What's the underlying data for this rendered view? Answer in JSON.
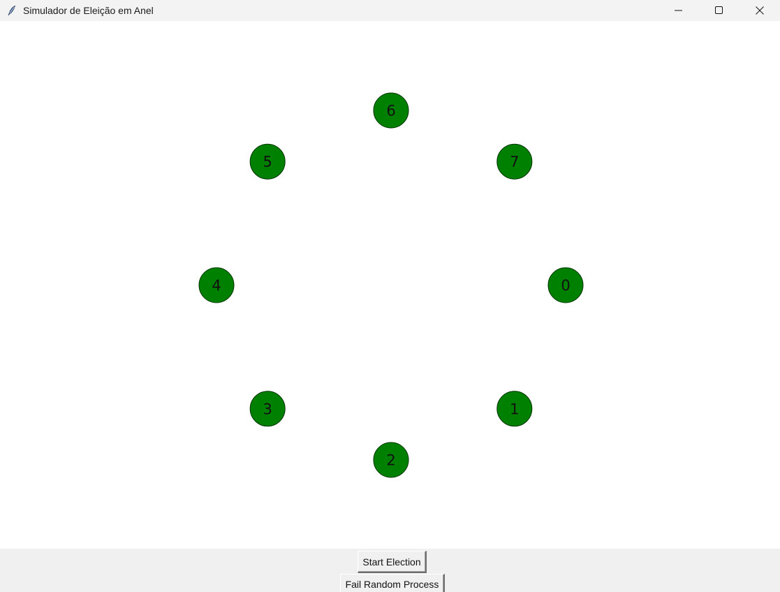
{
  "window": {
    "title": "Simulador de Eleição em Anel",
    "app_icon": "feather-icon",
    "controls": [
      "minimize-icon",
      "maximize-icon",
      "close-icon"
    ]
  },
  "ring": {
    "node_color": "#008000",
    "node_stroke": "#003300",
    "nodes": [
      {
        "label": "0"
      },
      {
        "label": "1"
      },
      {
        "label": "2"
      },
      {
        "label": "3"
      },
      {
        "label": "4"
      },
      {
        "label": "5"
      },
      {
        "label": "6"
      },
      {
        "label": "7"
      }
    ]
  },
  "buttons": {
    "start_election": "Start Election",
    "fail_random": "Fail Random Process"
  }
}
